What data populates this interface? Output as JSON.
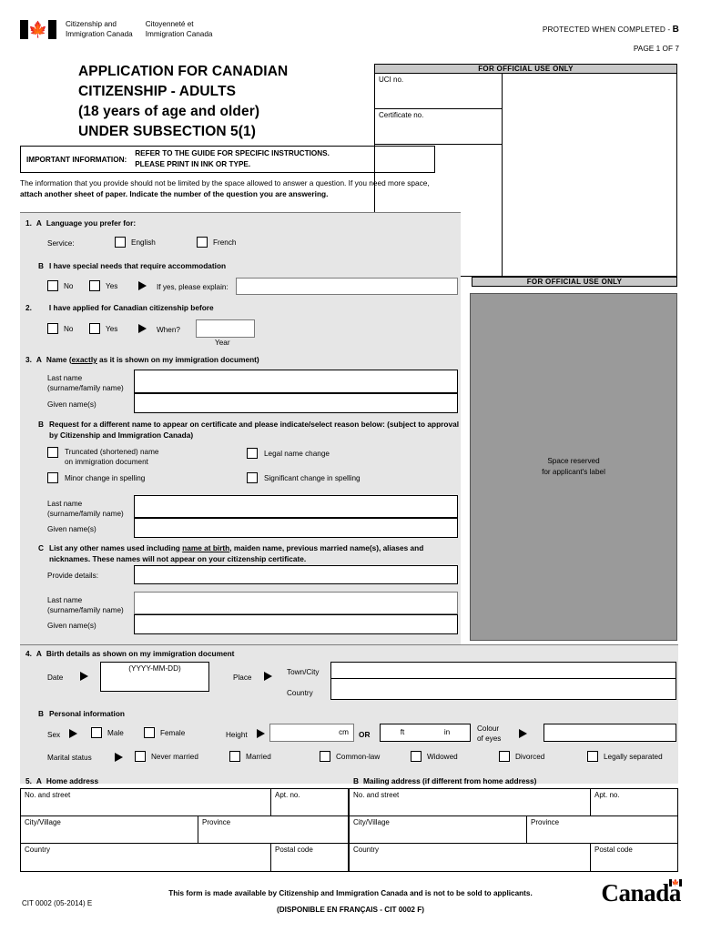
{
  "header": {
    "dept_en_line1": "Citizenship and",
    "dept_en_line2": "Immigration Canada",
    "dept_fr_line1": "Citoyenneté et",
    "dept_fr_line2": "Immigration Canada",
    "protected_text": "PROTECTED WHEN COMPLETED - ",
    "protected_level": "B",
    "page_of": "PAGE 1 OF 7",
    "flag_icon": "canada-flag-icon"
  },
  "title": {
    "line1": "APPLICATION FOR CANADIAN",
    "line2": "CITIZENSHIP - ADULTS",
    "line3": "(18 years of age and older)",
    "line4": "UNDER SUBSECTION 5(1)"
  },
  "important": {
    "label": "IMPORTANT INFORMATION:",
    "line1": "REFER TO THE GUIDE FOR SPECIFIC INSTRUCTIONS.",
    "line2": "PLEASE PRINT IN INK OR TYPE."
  },
  "note": {
    "part1": "The information that you provide should not be limited by the space allowed to answer a question. If you need more space, ",
    "bold1": "attach another sheet of paper. Indicate the number of the question you are answering."
  },
  "official_use": {
    "bar_title": "FOR OFFICIAL USE ONLY",
    "uci_label": "UCI no.",
    "certificate_label": "Certificate no.",
    "label_bar_title": "FOR OFFICIAL USE ONLY",
    "label_space_line1": "Space reserved",
    "label_space_line2": "for applicant's label"
  },
  "q1": {
    "num": "1.",
    "a_letter": "A",
    "a_title": "Language you prefer for:",
    "service_label": "Service:",
    "english": "English",
    "french": "French",
    "b_letter": "B",
    "b_title": "I have special needs that require accommodation",
    "no": "No",
    "yes": "Yes",
    "explain": "If yes, please explain:"
  },
  "q2": {
    "num": "2.",
    "title": "I have applied for Canadian citizenship before",
    "no": "No",
    "yes": "Yes",
    "when": "When?",
    "year": "Year"
  },
  "q3": {
    "num": "3.",
    "a_letter": "A",
    "a_title_pre": "Name (",
    "a_title_u": "exactly",
    "a_title_post": " as it is shown on my immigration document)",
    "last_name_l1": "Last name",
    "last_name_l2": "(surname/family name)",
    "given_name": "Given name(s)",
    "b_letter": "B",
    "b_title": "Request for a different name to appear on certificate and please indicate/select reason below: (subject to approval by Citizenship and Immigration Canada)",
    "opt_truncated_l1": "Truncated (shortened) name",
    "opt_truncated_l2": "on immigration document",
    "opt_legal": "Legal name change",
    "opt_minor": "Minor change in spelling",
    "opt_significant": "Significant change in spelling",
    "c_letter": "C",
    "c_title_pre": "List any other names used including ",
    "c_title_u": "name at birth",
    "c_title_post": ", maiden name, previous married name(s), aliases and nicknames. These names will not appear on your citizenship certificate.",
    "provide_details": "Provide details:"
  },
  "q4": {
    "num": "4.",
    "a_letter": "A",
    "a_title": "Birth details as shown on my immigration document",
    "date_label": "Date",
    "date_format": "(YYYY-MM-DD)",
    "place_label": "Place",
    "town_city": "Town/City",
    "country": "Country",
    "b_letter": "B",
    "b_title": "Personal information",
    "sex_label": "Sex",
    "male": "Male",
    "female": "Female",
    "height_label": "Height",
    "cm": "cm",
    "or": "OR",
    "ft": "ft",
    "in": "in",
    "colour_eyes_l1": "Colour",
    "colour_eyes_l2": "of eyes",
    "marital_label": "Marital status",
    "marital_options": [
      "Never married",
      "Married",
      "Common-law",
      "Widowed",
      "Divorced",
      "Legally separated"
    ]
  },
  "q5": {
    "num": "5.",
    "a_letter": "A",
    "a_title": "Home address",
    "b_letter": "B",
    "b_title": "Mailing address (if different from home address)",
    "fields": {
      "no_and_street": "No. and street",
      "apt_no": "Apt. no.",
      "city_village": "City/Village",
      "province": "Province",
      "country": "Country",
      "postal_code": "Postal code"
    }
  },
  "footer": {
    "form_code": "CIT 0002 (05-2014) E",
    "availability": "This form is made available by Citizenship and Immigration Canada and is not to be sold to applicants.",
    "french_version": "(DISPONIBLE EN FRANÇAIS - CIT 0002 F)",
    "wordmark": "Canad",
    "wordmark_tail": "a",
    "wordmark_flag_icon": "canada-flag-icon"
  },
  "colors": {
    "panel_grey": "#e6e6e6",
    "bar_grey": "#c9c9c9",
    "label_grey": "#9a9a9a",
    "line": "#000000"
  }
}
